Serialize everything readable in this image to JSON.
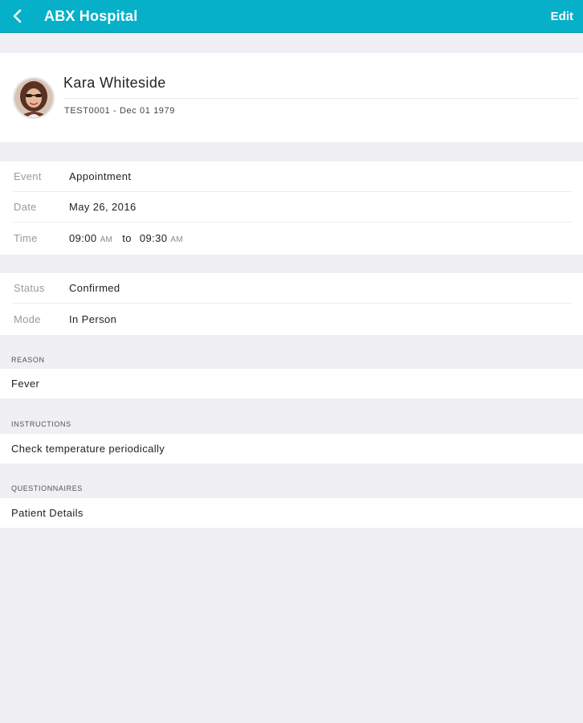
{
  "header": {
    "title": "ABX Hospital",
    "edit_label": "Edit",
    "back_icon": "chevron-left-icon",
    "bg_color": "#06b0c9"
  },
  "patient": {
    "name": "Kara Whiteside",
    "subtitle": "TEST0001 - Dec 01 1979"
  },
  "event_details": [
    {
      "label": "Event",
      "value": "Appointment"
    },
    {
      "label": "Date",
      "value": "May 26, 2016"
    }
  ],
  "time_row": {
    "label": "Time",
    "start": "09:00",
    "start_ampm": "AM",
    "to": "to",
    "end": "09:30",
    "end_ampm": "AM"
  },
  "status_details": [
    {
      "label": "Status",
      "value": "Confirmed"
    },
    {
      "label": "Mode",
      "value": "In Person"
    }
  ],
  "sections": [
    {
      "header": "REASON",
      "value": "Fever"
    },
    {
      "header": "INSTRUCTIONS",
      "value": "Check temperature periodically"
    },
    {
      "header": "QUESTIONNAIRES",
      "value": "Patient Details"
    }
  ]
}
